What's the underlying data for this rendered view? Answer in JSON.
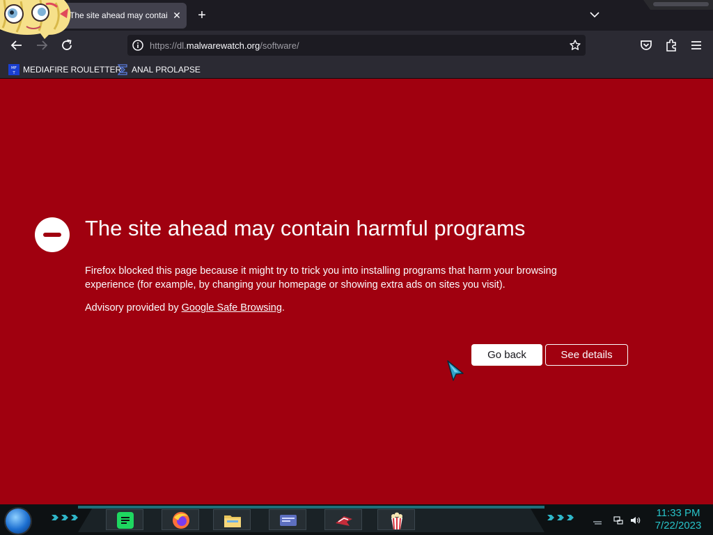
{
  "tab": {
    "title": "The site ahead may contain harmful programs",
    "close_label": "✕"
  },
  "tabstrip": {
    "new_tab_label": "+"
  },
  "urlbar": {
    "prefix": "https://dl.",
    "host": "malwarewatch.org",
    "path": "/software/"
  },
  "bookmarks": [
    {
      "label": "MEDIAFIRE ROULETTER",
      "icon": "mediafire-favicon"
    },
    {
      "label": "ANAL PROLAPSE",
      "icon": "sigma-favicon"
    }
  ],
  "error": {
    "title": "The site ahead may contain harmful programs",
    "description": "Firefox blocked this page because it might try to trick you into installing programs that harm your browsing experience (for example, by changing your homepage or showing extra ads on sites you visit).",
    "advisory_prefix": "Advisory provided by ",
    "advisory_link": "Google Safe Browsing",
    "advisory_suffix": ".",
    "go_back_label": "Go back",
    "see_details_label": "See details"
  },
  "taskbar": {
    "apps": [
      "spotify-icon",
      "firefox-icon",
      "file-explorer-icon",
      "window-card-icon",
      "game-ship-icon",
      "popcorn-icon"
    ]
  },
  "clock": {
    "time": "11:33 PM",
    "date": "7/22/2023"
  },
  "colors": {
    "page_bg": "#a0000f",
    "toolbar_bg": "#2b2a33",
    "tabstrip_bg": "#1c1b22",
    "clock_color": "#28c3c9"
  }
}
